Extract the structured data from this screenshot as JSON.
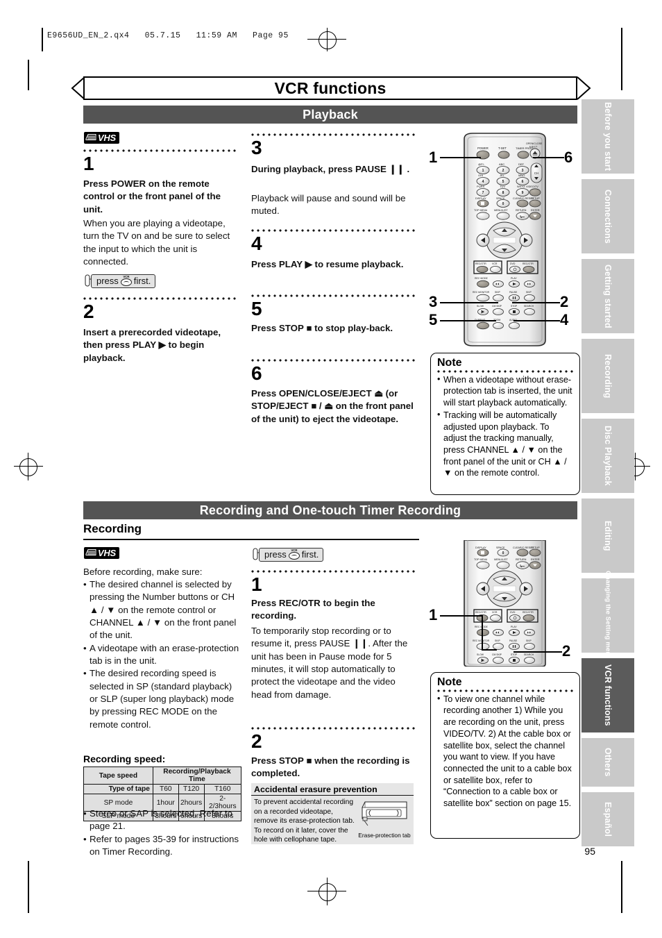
{
  "slug": "E9656UD_EN_2.qx4   05.7.15   11:59 AM   Page 95",
  "page_number": "95",
  "banner": {
    "title_bold": "VCR",
    "title_rest": " functions"
  },
  "sections": {
    "playback": {
      "bar": "Playback"
    },
    "recording": {
      "bar": "Recording and One-touch Timer Recording",
      "subhead": "Recording"
    }
  },
  "vhs_logo": "VHS",
  "press_first": {
    "text_before": "press",
    "text_after": "first.",
    "button_label": "VCR"
  },
  "playback_steps": [
    {
      "num": "1",
      "bold": "Press POWER on the remote control or the front panel of the unit.",
      "body": "When you are playing a videotape, turn the TV on and be sure to select the input to which the unit is connected."
    },
    {
      "num": "2",
      "bold": "Insert a prerecorded videotape, then press PLAY ▶ to begin playback.",
      "body": ""
    },
    {
      "num": "3",
      "bold": "During playback, press PAUSE ❙❙ .",
      "body": "Playback will pause and sound will be muted."
    },
    {
      "num": "4",
      "bold": "Press PLAY ▶ to resume playback.",
      "body": ""
    },
    {
      "num": "5",
      "bold": "Press STOP ■ to stop play-back.",
      "body": ""
    },
    {
      "num": "6",
      "bold": "Press OPEN/CLOSE/EJECT ⏏ (or STOP/EJECT ■ / ⏏ on the front panel of the unit) to eject the videotape.",
      "body": ""
    }
  ],
  "playback_note": {
    "title": "Note",
    "items": [
      "When a videotape without erase-protection tab is inserted, the unit will start playback automatically.",
      "Tracking will be automatically adjusted upon playback. To adjust the tracking manually, press CHANNEL ▲ / ▼ on the front panel of the unit or CH ▲ / ▼ on the remote control."
    ]
  },
  "recording_intro": {
    "lead": "Before recording, make sure:",
    "bullets": [
      "The desired channel is selected by pressing the Number buttons or CH ▲ / ▼ on the remote control or CHANNEL ▲ / ▼ on the front panel of the unit.",
      "A videotape with an erase-protection tab is in the unit.",
      "The desired recording speed is selected in SP (standard playback) or SLP (super long playback) mode by pressing REC MODE on the remote control."
    ],
    "after_bullets": [
      "Stereo or SAP is selected. Refer to page 21.",
      "Refer to pages 35-39 for instructions on Timer Recording."
    ]
  },
  "recording_speed": {
    "caption": "Recording speed:",
    "header_left": "Tape speed",
    "header_right": "Recording/Playback Time",
    "row_label": "Type of tape",
    "tape_types": [
      "T60",
      "T120",
      "T160"
    ],
    "rows": [
      {
        "mode": "SP mode",
        "values": [
          "1hour",
          "2hours",
          "2-2/3hours"
        ]
      },
      {
        "mode": "SLP mode",
        "values": [
          "3hours",
          "6hours",
          "8hours"
        ]
      }
    ]
  },
  "recording_steps": [
    {
      "num": "1",
      "bold": "Press REC/OTR to begin the recording.",
      "body": "To temporarily stop recording or to resume it, press PAUSE ❙❙. After the unit has been in Pause mode for 5 minutes, it will stop automatically to protect the videotape and the video head from damage."
    },
    {
      "num": "2",
      "bold": "Press STOP ■ when the recording is completed.",
      "body": ""
    }
  ],
  "erasure_box": {
    "title": "Accidental erasure prevention",
    "text": "To prevent accidental recording on a recorded videotape, remove its erase-protection tab. To record on it later, cover the hole with cellophane tape.",
    "caption": "Erase-protection tab"
  },
  "recording_note": {
    "title": "Note",
    "items": [
      "To view one channel while recording another 1) While you are recording on the unit, press VIDEO/TV. 2) At the cable box or satellite box, select the channel you want to view. If you have connected the unit to a cable box or satellite box, refer to “Connection to a cable box or satellite box” section on page 15."
    ]
  },
  "side_tabs": [
    {
      "label": "Before you start",
      "active": false
    },
    {
      "label": "Connections",
      "active": false
    },
    {
      "label": "Getting started",
      "active": false
    },
    {
      "label": "Recording",
      "active": false
    },
    {
      "label": "Disc Playback",
      "active": false
    },
    {
      "label": "Editing",
      "active": false
    },
    {
      "label": "Changing the Setting menu",
      "active": false
    },
    {
      "label": "VCR functions",
      "active": true
    },
    {
      "label": "Others",
      "active": false
    },
    {
      "label": "Español",
      "active": false
    }
  ],
  "remote_top": {
    "callouts": [
      "1",
      "6",
      "3",
      "2",
      "5",
      "4"
    ],
    "buttons": [
      "POWER",
      "T-SET",
      "TIMER PROG.",
      "OPEN/CLOSE EJECT",
      "1",
      "2",
      "3",
      "CH",
      "4",
      "5",
      "6",
      "7",
      "8",
      "9",
      "VIDEO/TV",
      "DISPLAY",
      "SPACE",
      "CLEAR/C.RESET",
      "SETUP",
      "TOP MENU",
      "MENU/LIST",
      "RETURN",
      "ENTER",
      "REC/OTR",
      "VCR",
      "DVD",
      "REC/OTR",
      "REC MODE",
      "PLAY",
      "REC MONITOR",
      "SKIP",
      "PAUSE",
      "SKIP",
      "SLOW",
      "CM SKIP",
      "STOP",
      "SEARCH",
      "DUBBING",
      "ZOOM",
      "AUDIO"
    ],
    "keypad_letters": [
      "@P/:",
      "ABC",
      "DEF",
      "GHI",
      "JKL",
      "MNO",
      "PQRS",
      "TUV",
      "WXYZ",
      "0"
    ]
  },
  "remote_bottom": {
    "callouts": [
      "1",
      "2"
    ],
    "buttons": [
      "DISPLAY",
      "SPACE",
      "CLEAR/C.RESET",
      "SETUP",
      "TOP MENU",
      "MENU/LIST",
      "RETURN",
      "ENTER",
      "REC/OTR",
      "VCR",
      "DVD",
      "REC/OTR",
      "REC MODE",
      "PLAY",
      "REC MONITOR",
      "SKIP",
      "PAUSE",
      "SKIP",
      "SLOW",
      "CM SKIP",
      "STOP",
      "SEARCH"
    ]
  },
  "colors": {
    "bar": "#545454",
    "tab_inactive": "#c9c9c9",
    "tab_active": "#5b5b5b",
    "panel": "#e6e6e6"
  }
}
